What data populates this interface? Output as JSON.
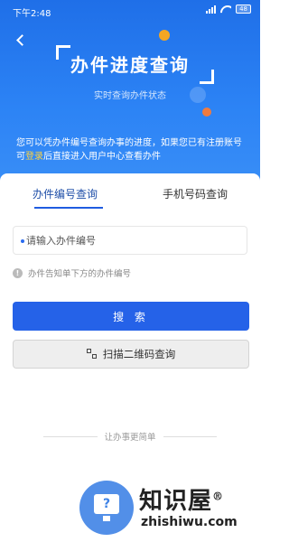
{
  "status_bar": {
    "time": "下午2:48",
    "battery": "48"
  },
  "header": {
    "title": "办件进度查询",
    "subtitle": "实时查询办件状态",
    "desc_before": "您可以凭办件编号查询办事的进度，如果您已有注册账号可",
    "login_link": "登录",
    "desc_after": "后直接进入用户中心查看办件"
  },
  "tabs": [
    {
      "label": "办件编号查询",
      "active": true
    },
    {
      "label": "手机号码查询",
      "active": false
    }
  ],
  "search": {
    "placeholder": "请输入办件编号",
    "value": ""
  },
  "hint": "办件告知单下方的办件编号",
  "buttons": {
    "search_label": "搜 索",
    "scan_label": "扫描二维码查询"
  },
  "footer": {
    "slogan": "让办事更简单"
  },
  "watermark": {
    "name": "知识屋",
    "domain": "zhishiwu.com",
    "mark": "®"
  },
  "colors": {
    "primary": "#2562e8",
    "hero": "#2c83f5",
    "accent_orange": "#f5a623",
    "link_yellow": "#ffd23f"
  }
}
